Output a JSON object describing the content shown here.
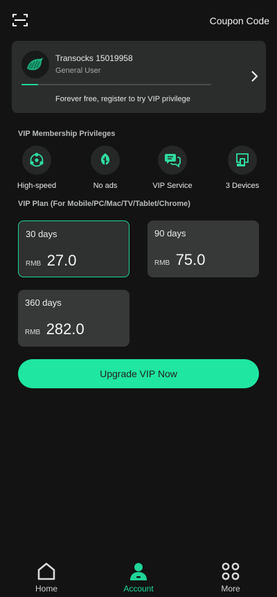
{
  "topbar": {
    "coupon_label": "Coupon Code"
  },
  "user": {
    "name": "Transocks 15019958",
    "type": "General User",
    "promo": "Forever free, register to try VIP privilege"
  },
  "privileges": {
    "title": "VIP Membership Privileges",
    "items": [
      {
        "label": "High-speed",
        "icon": "speed-network-icon"
      },
      {
        "label": "No ads",
        "icon": "leaf-icon"
      },
      {
        "label": "VIP Service",
        "icon": "chat-service-icon"
      },
      {
        "label": "3 Devices",
        "icon": "devices-icon"
      }
    ]
  },
  "plans": {
    "title": "VIP Plan (For Mobile/PC/Mac/TV/Tablet/Chrome)",
    "items": [
      {
        "days": "30 days",
        "currency": "RMB",
        "amount": "27.0",
        "selected": true
      },
      {
        "days": "90 days",
        "currency": "RMB",
        "amount": "75.0",
        "selected": false
      },
      {
        "days": "360 days",
        "currency": "RMB",
        "amount": "282.0",
        "selected": false
      }
    ]
  },
  "upgrade_label": "Upgrade VIP Now",
  "nav": {
    "items": [
      {
        "label": "Home",
        "icon": "home-icon"
      },
      {
        "label": "Account",
        "icon": "account-icon",
        "active": true
      },
      {
        "label": "More",
        "icon": "more-grid-icon"
      }
    ]
  },
  "colors": {
    "accent": "#1fe6a1",
    "background": "#121312",
    "card": "#373938"
  }
}
